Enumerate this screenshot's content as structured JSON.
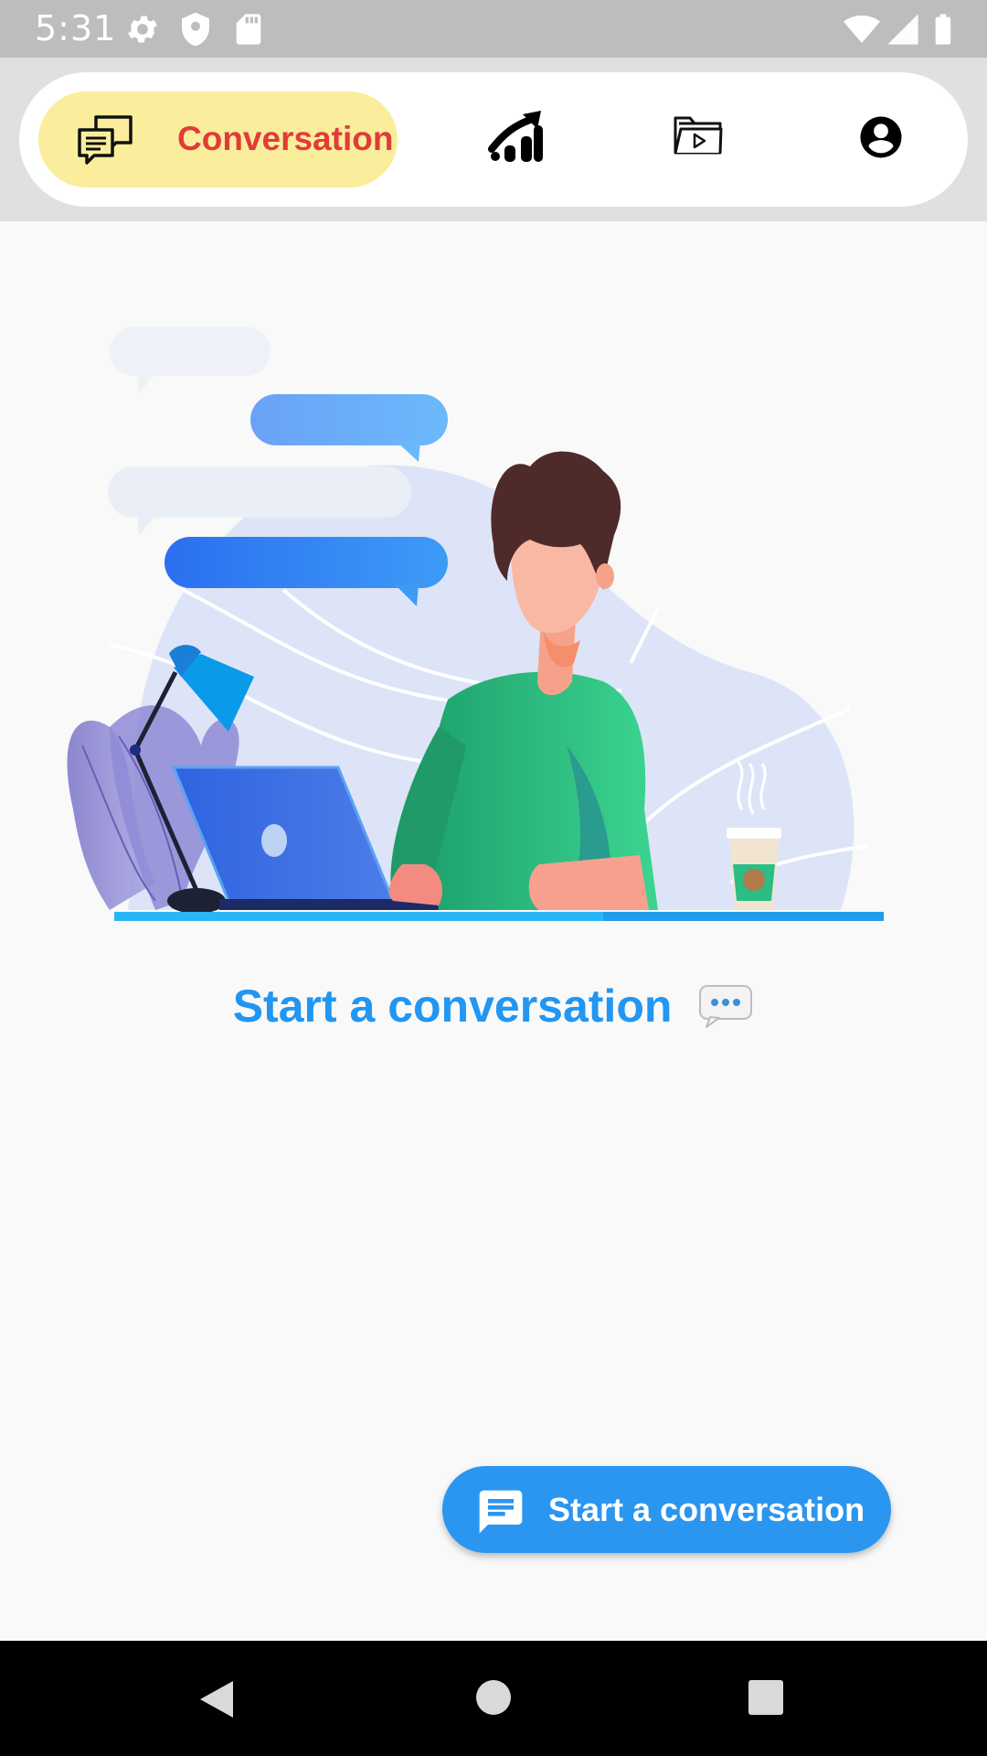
{
  "status_bar": {
    "time": "5:31",
    "left_icons": [
      "settings-icon",
      "shield-icon",
      "sd-card-icon"
    ],
    "right_icons": [
      "wifi-icon",
      "signal-icon",
      "battery-icon"
    ]
  },
  "nav": {
    "active_tab_label": "Conversation",
    "tabs": [
      "chat-bubbles-icon",
      "trending-up-icon",
      "video-folder-icon",
      "account-circle-icon"
    ]
  },
  "content": {
    "headline": "Start a conversation",
    "headline_icon": "speech-balloon-icon"
  },
  "fab": {
    "label": "Start a conversation",
    "icon": "message-icon"
  },
  "colors": {
    "accent": "#2196f3",
    "active_tab_bg": "#faee9c",
    "active_tab_text": "#e33a3a",
    "fab_bg": "#2a96f0"
  }
}
